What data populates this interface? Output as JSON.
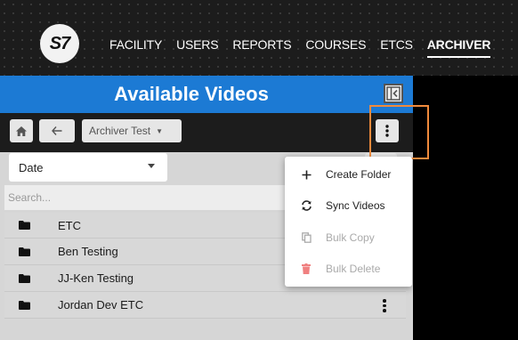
{
  "navbar": {
    "logo_text": "S7",
    "items": [
      {
        "label": "FACILITY",
        "active": false
      },
      {
        "label": "USERS",
        "active": false
      },
      {
        "label": "REPORTS",
        "active": false
      },
      {
        "label": "COURSES",
        "active": false
      },
      {
        "label": "ETCS",
        "active": false
      },
      {
        "label": "ARCHIVER",
        "active": true
      }
    ]
  },
  "panel": {
    "title": "Available Videos",
    "toolbar": {
      "home_icon": "home-icon",
      "back_icon": "arrow-left-icon",
      "folder_selector": "Archiver Test",
      "more_icon": "kebab-icon"
    },
    "sort_select": {
      "value": "Date"
    },
    "search": {
      "placeholder": "Search..."
    },
    "items": [
      {
        "name": "ETC"
      },
      {
        "name": "Ben Testing"
      },
      {
        "name": "JJ-Ken Testing"
      },
      {
        "name": "Jordan Dev ETC"
      }
    ]
  },
  "menu": {
    "items": [
      {
        "label": "Create Folder",
        "icon": "plus-icon",
        "enabled": true
      },
      {
        "label": "Sync Videos",
        "icon": "sync-icon",
        "enabled": true
      },
      {
        "label": "Bulk Copy",
        "icon": "copy-icon",
        "enabled": false
      },
      {
        "label": "Bulk Delete",
        "icon": "trash-icon",
        "enabled": false
      }
    ]
  },
  "colors": {
    "header_blue": "#1c7ad4",
    "highlight_orange": "#f08a3c",
    "trash_red": "#f08080"
  }
}
